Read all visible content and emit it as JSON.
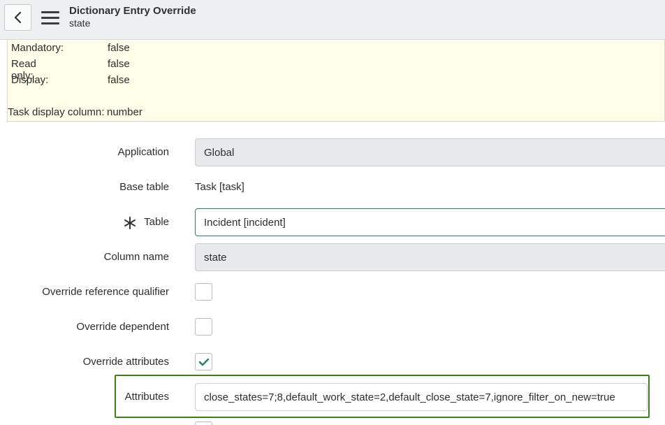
{
  "header": {
    "title": "Dictionary Entry Override",
    "subtitle": "state"
  },
  "info": [
    {
      "label": "Mandatory:",
      "value": "false"
    },
    {
      "label": "Read only:",
      "value": "false"
    },
    {
      "label": "Display:",
      "value": "false"
    },
    {
      "label": "Task display column:",
      "value": "number"
    }
  ],
  "form": {
    "application": {
      "label": "Application",
      "value": "Global"
    },
    "base_table": {
      "label": "Base table",
      "value": "Task [task]"
    },
    "table": {
      "label": "Table",
      "value": "Incident [incident]"
    },
    "column_name": {
      "label": "Column name",
      "value": "state"
    },
    "override_reference_qualifier": {
      "label": "Override reference qualifier",
      "checked": false
    },
    "override_dependent": {
      "label": "Override dependent",
      "checked": false
    },
    "override_attributes": {
      "label": "Override attributes",
      "checked": true
    },
    "attributes": {
      "label": "Attributes",
      "value": "close_states=7;8,default_work_state=2,default_close_state=7,ignore_filter_on_new=true"
    }
  },
  "colors": {
    "accent": "#2f7c6b",
    "highlight_border": "#3f7d1f",
    "info_background": "#fefee9",
    "header_background": "#eef0f1"
  }
}
